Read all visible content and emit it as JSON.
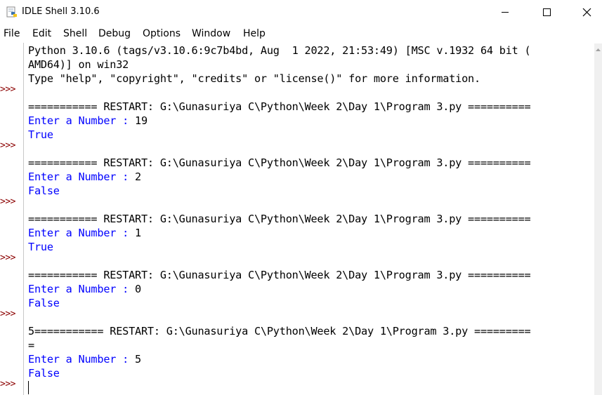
{
  "window": {
    "title": "IDLE Shell 3.10.6",
    "icon": "python-idle-icon",
    "controls": [
      "minimize-icon",
      "maximize-icon",
      "close-icon"
    ]
  },
  "menubar": {
    "items": [
      "File",
      "Edit",
      "Shell",
      "Debug",
      "Options",
      "Window",
      "Help"
    ]
  },
  "prompt_symbol": ">>>",
  "shell": {
    "lines": [
      {
        "segments": [
          {
            "text": "Python 3.10.6 (tags/v3.10.6:9c7b4bd, Aug  1 2022, 21:53:49) [MSC v.1932 64 bit (",
            "kind": "stdout"
          }
        ]
      },
      {
        "segments": [
          {
            "text": "AMD64)] on win32",
            "kind": "stdout"
          }
        ]
      },
      {
        "segments": [
          {
            "text": "Type \"help\", \"copyright\", \"credits\" or \"license()\" for more information.",
            "kind": "stdout"
          }
        ]
      },
      {
        "prompt": true,
        "segments": [
          {
            "text": "",
            "kind": "stdout"
          }
        ]
      },
      {
        "segments": [
          {
            "text": "=========== RESTART: G:\\Gunasuriya C\\Python\\Week 2\\Day 1\\Program 3.py ==========",
            "kind": "stdout"
          }
        ]
      },
      {
        "segments": [
          {
            "text": "Enter a Number : ",
            "kind": "stdin-prompt"
          },
          {
            "text": "19",
            "kind": "stdin-val"
          }
        ]
      },
      {
        "segments": [
          {
            "text": "True",
            "kind": "stdin-prompt"
          }
        ]
      },
      {
        "prompt": true,
        "segments": [
          {
            "text": "",
            "kind": "stdout"
          }
        ]
      },
      {
        "segments": [
          {
            "text": "=========== RESTART: G:\\Gunasuriya C\\Python\\Week 2\\Day 1\\Program 3.py ==========",
            "kind": "stdout"
          }
        ]
      },
      {
        "segments": [
          {
            "text": "Enter a Number : ",
            "kind": "stdin-prompt"
          },
          {
            "text": "2",
            "kind": "stdin-val"
          }
        ]
      },
      {
        "segments": [
          {
            "text": "False",
            "kind": "stdin-prompt"
          }
        ]
      },
      {
        "prompt": true,
        "segments": [
          {
            "text": "",
            "kind": "stdout"
          }
        ]
      },
      {
        "segments": [
          {
            "text": "=========== RESTART: G:\\Gunasuriya C\\Python\\Week 2\\Day 1\\Program 3.py ==========",
            "kind": "stdout"
          }
        ]
      },
      {
        "segments": [
          {
            "text": "Enter a Number : ",
            "kind": "stdin-prompt"
          },
          {
            "text": "1",
            "kind": "stdin-val"
          }
        ]
      },
      {
        "segments": [
          {
            "text": "True",
            "kind": "stdin-prompt"
          }
        ]
      },
      {
        "prompt": true,
        "segments": [
          {
            "text": "",
            "kind": "stdout"
          }
        ]
      },
      {
        "segments": [
          {
            "text": "=========== RESTART: G:\\Gunasuriya C\\Python\\Week 2\\Day 1\\Program 3.py ==========",
            "kind": "stdout"
          }
        ]
      },
      {
        "segments": [
          {
            "text": "Enter a Number : ",
            "kind": "stdin-prompt"
          },
          {
            "text": "0",
            "kind": "stdin-val"
          }
        ]
      },
      {
        "segments": [
          {
            "text": "False",
            "kind": "stdin-prompt"
          }
        ]
      },
      {
        "prompt": true,
        "segments": [
          {
            "text": "",
            "kind": "stdout"
          }
        ]
      },
      {
        "segments": [
          {
            "text": "5=========== RESTART: G:\\Gunasuriya C\\Python\\Week 2\\Day 1\\Program 3.py =========",
            "kind": "stdout"
          }
        ]
      },
      {
        "segments": [
          {
            "text": "=",
            "kind": "stdout"
          }
        ]
      },
      {
        "segments": [
          {
            "text": "Enter a Number : ",
            "kind": "stdin-prompt"
          },
          {
            "text": "5",
            "kind": "stdin-val"
          }
        ]
      },
      {
        "segments": [
          {
            "text": "False",
            "kind": "stdin-prompt"
          }
        ]
      },
      {
        "prompt": true,
        "segments": [
          {
            "text": "",
            "kind": "stdout"
          }
        ]
      }
    ]
  },
  "colors": {
    "stdout": "#000000",
    "stdin_prompt": "#0000ff",
    "prompt": "#8b0000",
    "gutter_border": "#c8c8c8"
  }
}
